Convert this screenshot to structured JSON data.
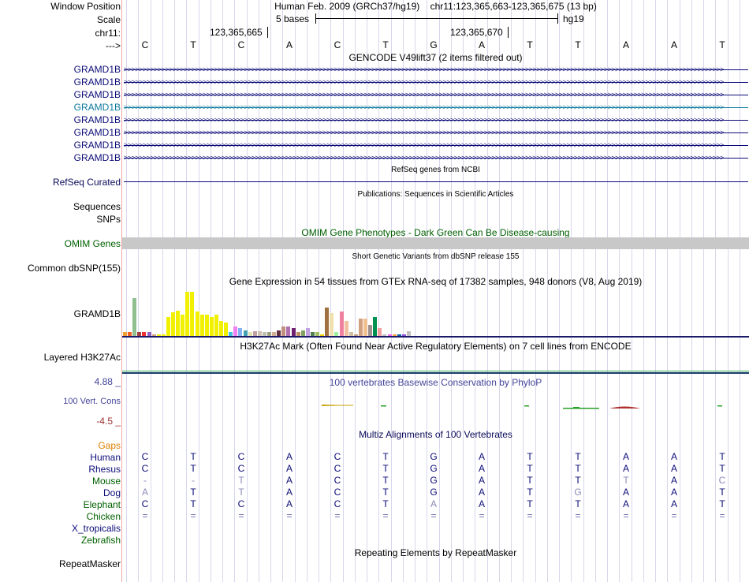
{
  "colors": {
    "gencode": "#0c0c78",
    "gencode_highlight": "#0e7a9c",
    "refseq": "#0c0c78",
    "omim_bar": "#c8c8c8",
    "omim_text": "#006000",
    "gaps": "#e08000",
    "conservation": "#44449a",
    "cons_neg": "#a03030",
    "layered": "#1a6a3a"
  },
  "header": {
    "window_position_label": "Window Position",
    "position_text": "Human Feb. 2009 (GRCh37/hg19)    chr11:123,365,663-123,365,675 (13 bp)",
    "scale_label": "Scale",
    "scale_text": "5 bases",
    "scale_assembly": "hg19",
    "chrom_label": "chr11:",
    "coord_ticks": [
      "123,365,665",
      "123,365,670"
    ],
    "strand_label": "--->",
    "bases": [
      "C",
      "T",
      "C",
      "A",
      "C",
      "T",
      "G",
      "A",
      "T",
      "T",
      "A",
      "A",
      "T"
    ]
  },
  "tracks": {
    "gencode": {
      "title": "GENCODE V49lift37 (2 items filtered out)",
      "genes": [
        "GRAMD1B",
        "GRAMD1B",
        "GRAMD1B",
        "GRAMD1B",
        "GRAMD1B",
        "GRAMD1B",
        "GRAMD1B",
        "GRAMD1B"
      ],
      "highlight_index": 3
    },
    "refseq": {
      "title": "RefSeq genes from NCBI",
      "label": "RefSeq Curated"
    },
    "publications": {
      "title": "Publications: Sequences in Scientific Articles",
      "labels": [
        "Sequences",
        "SNPs"
      ]
    },
    "omim": {
      "title": "OMIM Gene Phenotypes - Dark Green Can Be Disease-causing",
      "label": "OMIM Genes"
    },
    "dbsnp": {
      "title": "Short Genetic Variants from dbSNP release 155",
      "label": "Common dbSNP(155)"
    },
    "gtex": {
      "title": "Gene Expression in 54 tissues from GTEx RNA-seq of 17382 samples, 948 donors (V8, Aug 2019)",
      "label": "GRAMD1B",
      "levels": [
        0.1,
        0.1,
        1.0,
        0.1,
        0.1,
        0.1,
        0.05,
        0.05,
        0.05,
        0.5,
        0.62,
        0.67,
        0.55,
        1.15,
        1.15,
        0.65,
        0.55,
        0.55,
        0.5,
        0.55,
        0.4,
        0.35,
        0.1,
        0.25,
        0.2,
        0.15,
        0.1,
        0.12,
        0.12,
        0.1,
        0.1,
        0.1,
        0.15,
        0.25,
        0.25,
        0.2,
        0.1,
        0.15,
        0.2,
        0.1,
        0.1,
        0.05,
        0.75,
        0.6,
        0.1,
        0.65,
        0.4,
        0.1,
        0.05,
        0.45,
        0.45,
        0.3,
        0.5,
        0.2,
        0.05,
        0.05,
        0.05,
        0.05,
        0.05,
        0.12
      ],
      "bar_colors": [
        "#f0a030",
        "#f06020",
        "#90c090",
        "#a04040",
        "#f03030",
        "#9060c0",
        "#d0a080",
        "#f0f000",
        "#f0f000",
        "#f0f000",
        "#f0f000",
        "#f0f000",
        "#f0f000",
        "#f0f000",
        "#f0f000",
        "#f0f000",
        "#f0f000",
        "#f0f000",
        "#f0f000",
        "#f0f000",
        "#f0f000",
        "#f0f000",
        "#40c0e0",
        "#f080f0",
        "#80b0f0",
        "#40a0b0",
        "#e0e0b0",
        "#c0a0a0",
        "#d0c0b0",
        "#c0c0b0",
        "#a0a080",
        "#d0b090",
        "#603040",
        "#c09080",
        "#b070b0",
        "#702070",
        "#c09060",
        "#80a060",
        "#c0a0e0",
        "#508050",
        "#a0c060",
        "#f0d000",
        "#a07040",
        "#f0e0b0",
        "#a0f0a0",
        "#f080a0",
        "#f0c0a0",
        "#d0c0a0",
        "#c0a080",
        "#d0a080",
        "#f0c090",
        "#a09090",
        "#009050",
        "#f0a0a0",
        "#c0c0c0",
        "#f060f0",
        "#f0a040",
        "#0060a0",
        "#9050e0",
        "#c0c0c0"
      ]
    },
    "layered": {
      "title": "H3K27Ac Mark (Often Found Near Active Regulatory Elements) on 7 cell lines from ENCODE",
      "label": "Layered H3K27Ac"
    },
    "phylop": {
      "title": "100 vertebrates Basewise Conservation by PhyloP",
      "label": "100 Vert. Cons",
      "max_label": "4.88 _",
      "min_label": "-4.5 _"
    },
    "multiz": {
      "title": "Multiz Alignments of 100 Vertebrates",
      "gaps_label": "Gaps",
      "species": [
        {
          "name": "Human",
          "bases": [
            "C",
            "T",
            "C",
            "A",
            "C",
            "T",
            "G",
            "A",
            "T",
            "T",
            "A",
            "A",
            "T"
          ]
        },
        {
          "name": "Rhesus",
          "bases": [
            "C",
            "T",
            "C",
            "A",
            "C",
            "T",
            "G",
            "A",
            "T",
            "T",
            "A",
            "A",
            "T"
          ]
        },
        {
          "name": "Mouse",
          "bases": [
            "-",
            "-",
            "T",
            "A",
            "C",
            "T",
            "G",
            "A",
            "T",
            "T",
            "T",
            "A",
            "C"
          ]
        },
        {
          "name": "Dog",
          "bases": [
            "A",
            "T",
            "T",
            "A",
            "C",
            "T",
            "G",
            "A",
            "T",
            "G",
            "A",
            "A",
            "T"
          ]
        },
        {
          "name": "Elephant",
          "bases": [
            "C",
            "T",
            "C",
            "A",
            "C",
            "T",
            "A",
            "A",
            "T",
            "T",
            "A",
            "A",
            "T"
          ]
        },
        {
          "name": "Chicken",
          "bases": [
            "=",
            "=",
            "=",
            "=",
            "=",
            "=",
            "=",
            "=",
            "=",
            "=",
            "=",
            "=",
            "="
          ]
        },
        {
          "name": "X_tropicalis",
          "bases": []
        },
        {
          "name": "Zebrafish",
          "bases": []
        }
      ]
    },
    "repeatmasker": {
      "title": "Repeating Elements by RepeatMasker",
      "label": "RepeatMasker"
    }
  }
}
